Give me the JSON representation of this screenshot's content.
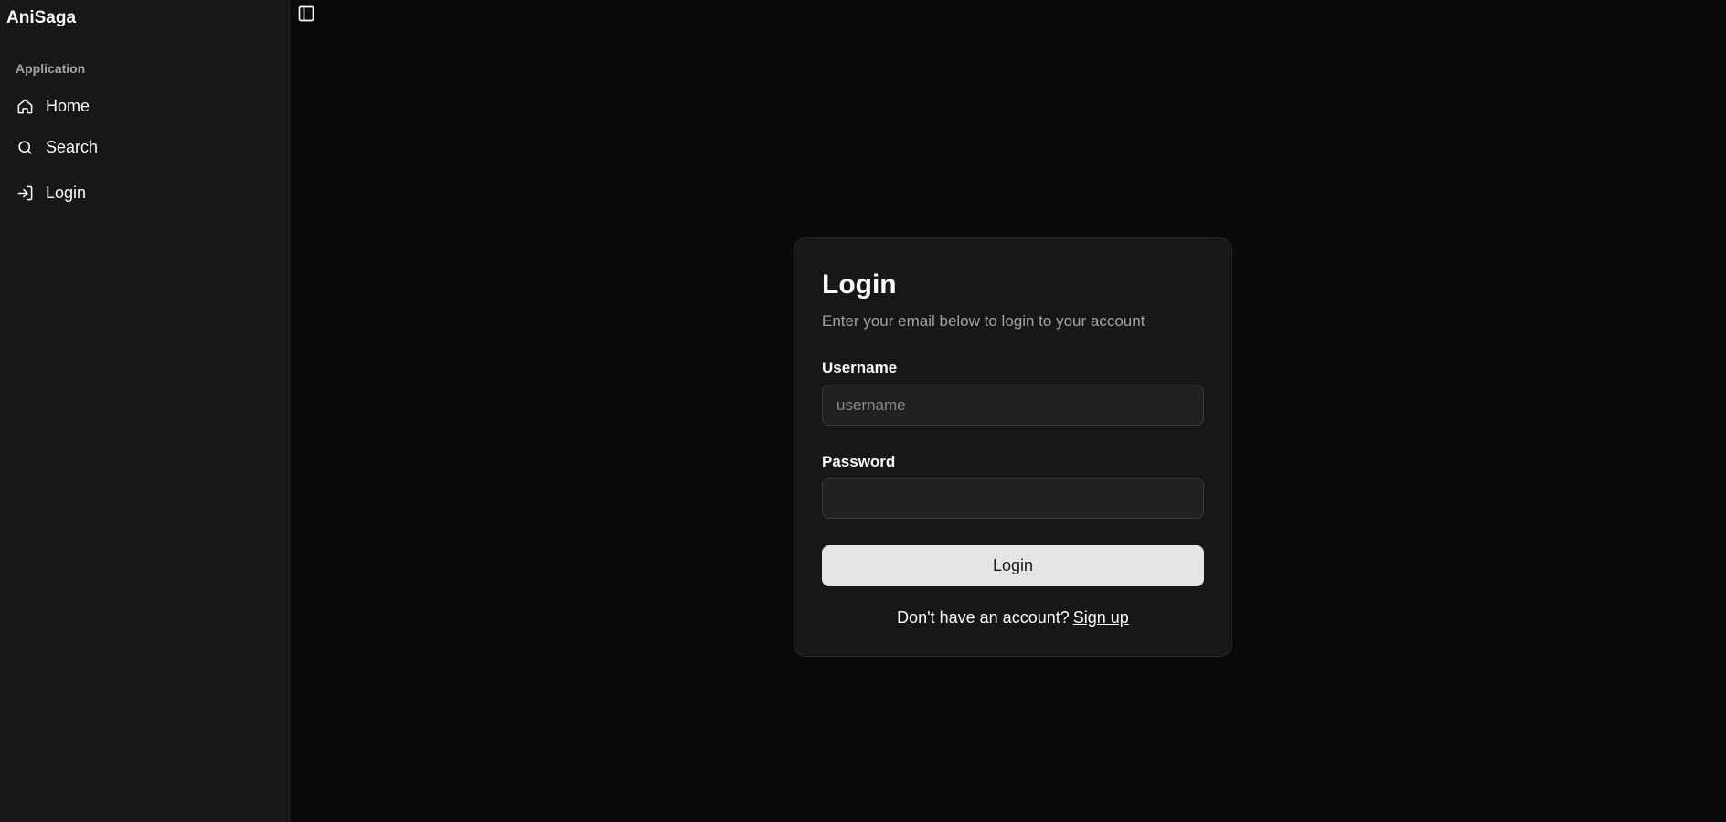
{
  "sidebar": {
    "brand": "AniSaga",
    "group_label": "Application",
    "items": [
      {
        "label": "Home",
        "icon": "home-icon"
      },
      {
        "label": "Search",
        "icon": "search-icon"
      },
      {
        "label": "Login",
        "icon": "login-icon"
      }
    ]
  },
  "header": {
    "toggle_icon": "sidebar-toggle-icon"
  },
  "login_card": {
    "title": "Login",
    "description": "Enter your email below to login to your account",
    "username_label": "Username",
    "username_placeholder": "username",
    "username_value": "",
    "password_label": "Password",
    "password_value": "",
    "submit_label": "Login",
    "signup_prompt": "Don't have an account?",
    "signup_link": "Sign up"
  },
  "colors": {
    "background": "#0a0a0a",
    "sidebar": "#171717",
    "card": "#171717",
    "button": "#e5e5e5",
    "muted_text": "#a3a3a3"
  }
}
